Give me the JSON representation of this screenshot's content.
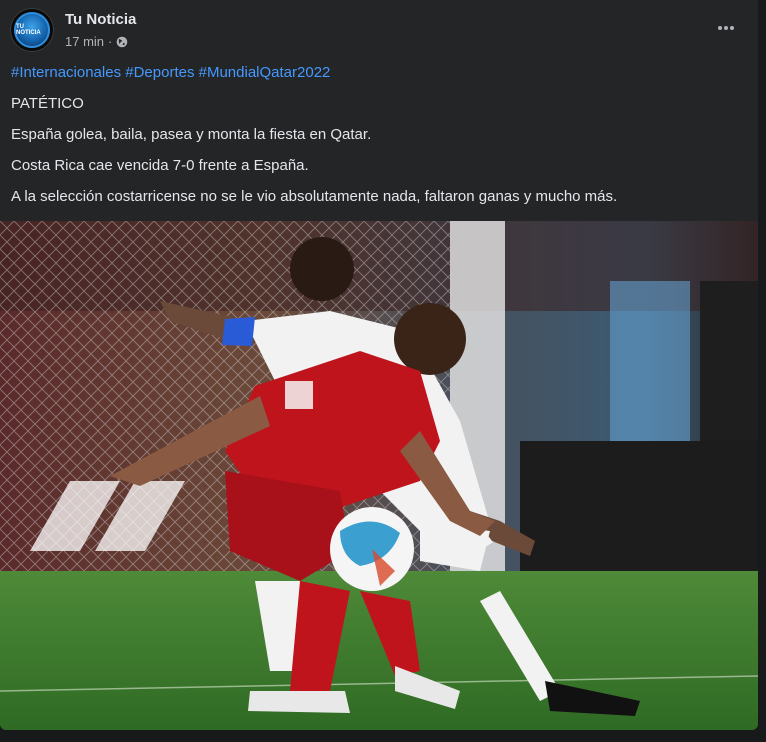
{
  "post": {
    "page_name": "Tu Noticia",
    "time": "17 min",
    "separator": "·",
    "privacy_icon": "globe-icon",
    "more_icon": "more-horizontal-icon",
    "avatar_text": "TU NOTICIA",
    "hashtags": "#Internacionales #Deportes #MundialQatar2022",
    "lines": [
      "PATÉTICO",
      "España golea, baila, pasea y monta la fiesta en Qatar.",
      "Costa Rica cae vencida 7-0 frente a España.",
      "A la selección costarricense no se le vio absolutamente nada, faltaron ganas y mucho más."
    ],
    "photo_alt": "Partido España vs Costa Rica"
  },
  "colors": {
    "background": "#18191a",
    "card": "#242526",
    "text": "#e4e6eb",
    "secondary_text": "#b0b3b8",
    "link": "#4599ff",
    "spain_red": "#c0141c",
    "costa_rica_white": "#f2f2f2",
    "pitch_green": "#3c7a2e"
  }
}
